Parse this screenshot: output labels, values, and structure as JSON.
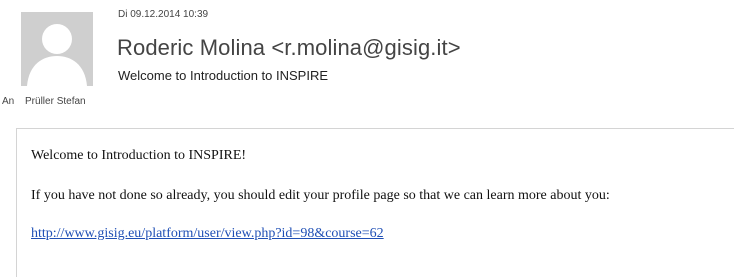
{
  "header": {
    "date": "Di 09.12.2014 10:39",
    "sender": "Roderic Molina <r.molina@gisig.it>",
    "subject": "Welcome to Introduction to INSPIRE",
    "to_label": "An",
    "to_value": "Prüller Stefan"
  },
  "message": {
    "line1": "Welcome to Introduction to INSPIRE!",
    "line2": "If you have not done so already, you should edit your profile page so that we can learn more about you:",
    "link_text": "http://www.gisig.eu/platform/user/view.php?id=98&course=62"
  },
  "colors": {
    "avatar_bg": "#cfcfcf",
    "avatar_icon": "#ffffff",
    "link": "#1f4fb5"
  },
  "icons": {
    "avatar": "user-avatar-icon"
  }
}
